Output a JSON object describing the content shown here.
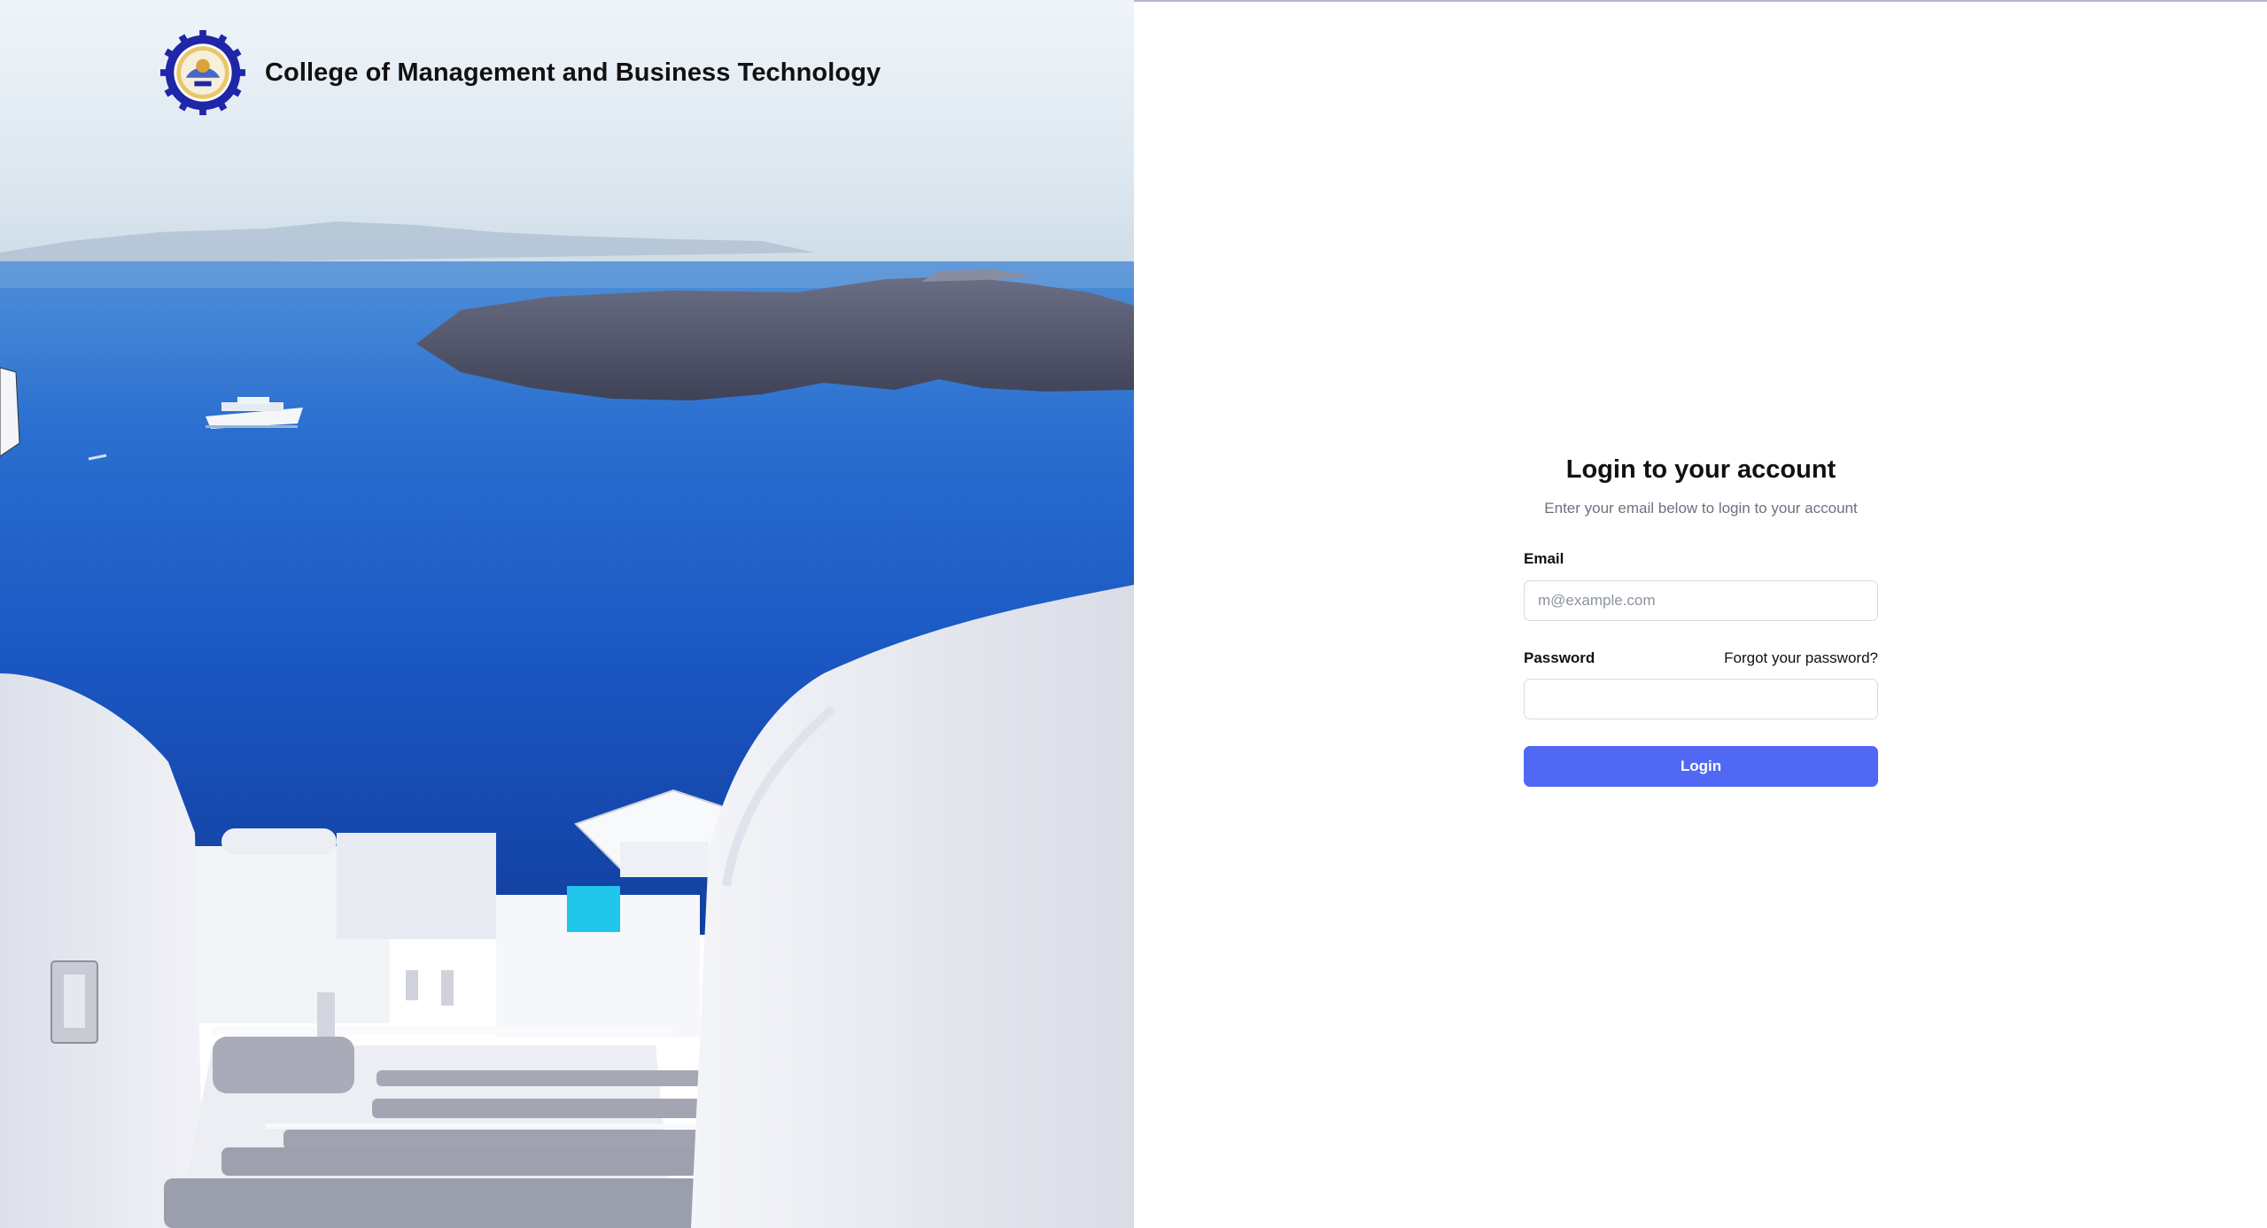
{
  "brand": {
    "name": "College of Management and Business Technology",
    "logo_icon": "college-seal-gear-icon"
  },
  "login": {
    "title": "Login to your account",
    "subtitle": "Enter your email below to login to your account",
    "email_label": "Email",
    "email_placeholder": "m@example.com",
    "email_value": "",
    "password_label": "Password",
    "forgot_link": "Forgot your password?",
    "password_value": "",
    "submit_label": "Login"
  },
  "colors": {
    "accent": "#5168f4",
    "sea": "#1f5fc9",
    "text": "#111111",
    "muted": "#6b7280"
  }
}
